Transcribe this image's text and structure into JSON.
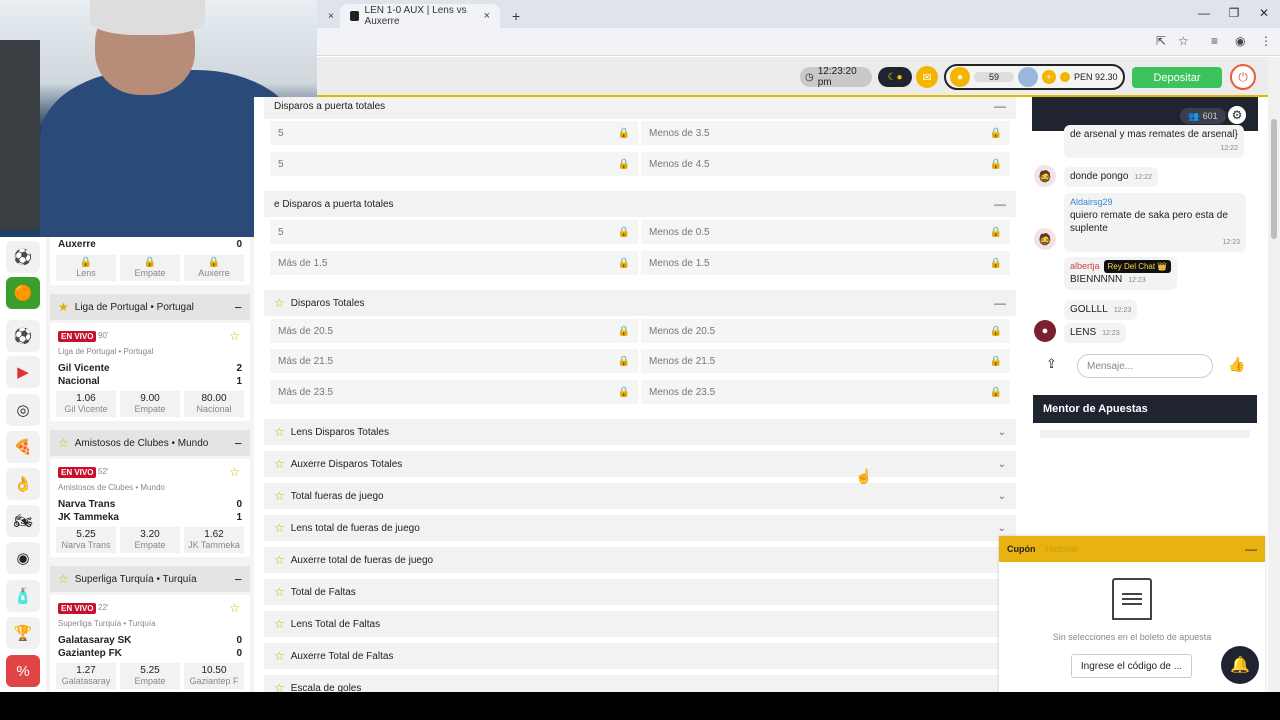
{
  "browser": {
    "tab_title": "LEN 1-0 AUX | Lens vs Auxerre",
    "close": "×",
    "new_tab": "+",
    "win_min": "—",
    "win_max": "❐",
    "win_close": "✕"
  },
  "header": {
    "clock": "12:23:20 pm",
    "coins": "59",
    "balance": "PEN 92.30",
    "deposit": "Depositar"
  },
  "rail": {
    "icons": [
      "soccer-ball-icon",
      "coin-icon",
      "soccer-ball-icon",
      "play-icon",
      "target-icon",
      "slot-icon",
      "hand-icon",
      "racing-icon",
      "roulette-icon",
      "bottle-icon",
      "trophy-icon",
      "percent-icon"
    ]
  },
  "matches": {
    "partial": {
      "team": "Auxerre",
      "score": "0",
      "odds": [
        "Lens",
        "Empate",
        "Auxerre"
      ]
    },
    "leagues": [
      {
        "name": "Liga de Portugal • Portugal",
        "live": "EN VIVO",
        "minute": "90'",
        "sub": "Liga de Portugal • Portugal",
        "home": "Gil Vicente",
        "home_score": "2",
        "away": "Nacional",
        "away_score": "1",
        "odds": [
          {
            "v": "1.06",
            "l": "Gil Vicente"
          },
          {
            "v": "9.00",
            "l": "Empate"
          },
          {
            "v": "80.00",
            "l": "Nacional"
          }
        ]
      },
      {
        "name": "Amistosos de Clubes • Mundo",
        "live": "EN VIVO",
        "minute": "52'",
        "sub": "Amistosos de Clubes • Mundo",
        "home": "Narva Trans",
        "home_score": "0",
        "away": "JK Tammeka",
        "away_score": "1",
        "odds": [
          {
            "v": "5.25",
            "l": "Narva Trans"
          },
          {
            "v": "3.20",
            "l": "Empate"
          },
          {
            "v": "1.62",
            "l": "JK Tammeka"
          }
        ]
      },
      {
        "name": "Superliga Turquía • Turquía",
        "live": "EN VIVO",
        "minute": "22'",
        "sub": "Superliga Turquía • Turquía",
        "home": "Galatasaray SK",
        "home_score": "0",
        "away": "Gaziantep FK",
        "away_score": "0",
        "odds": [
          {
            "v": "1.27",
            "l": "Galatasaray"
          },
          {
            "v": "5.25",
            "l": "Empate"
          },
          {
            "v": "10.50",
            "l": "Gaziantep F"
          }
        ]
      }
    ]
  },
  "markets": {
    "m1": {
      "title": "Disparos a puerta totales",
      "rows": [
        [
          "5",
          "Menos de 3.5"
        ],
        [
          "5",
          "Menos de 4.5"
        ]
      ]
    },
    "m2": {
      "title": "e Disparos a puerta totales",
      "rows": [
        [
          "5",
          "Menos de 0.5"
        ],
        [
          "Más de 1.5",
          "Menos de 1.5"
        ]
      ]
    },
    "m3": {
      "title": "Disparos Totales",
      "rows": [
        [
          "Más de 20.5",
          "Menos de 20.5"
        ],
        [
          "Más de 21.5",
          "Menos de 21.5"
        ],
        [
          "Más de 23.5",
          "Menos de 23.5"
        ]
      ]
    },
    "collapsed": [
      "Lens Disparos Totales",
      "Auxerre Disparos Totales",
      "Total fueras de juego",
      "Lens total de fueras de juego",
      "Auxerre total de fueras de juego",
      "Total de Faltas",
      "Lens Total de Faltas",
      "Auxerre Total de Faltas",
      "Escala de goles"
    ]
  },
  "chat": {
    "users": "601",
    "m0": "de arsenal y mas remates de arsenal}",
    "m0_time": "12:22",
    "m1": "donde pongo",
    "m1_time": "12:22",
    "m2_user": "Aldairsg29",
    "m2": "quiero remate de saka pero esta de suplente",
    "m2_time": "12:23",
    "m3_user": "albertja",
    "m3_badge": "Rey Del Chat 👑",
    "m3": "BIENNNNN",
    "m3_time": "12:23",
    "m4": "GOLLLL",
    "m4_time": "12:23",
    "m5": "LENS",
    "m5_time": "12:23",
    "placeholder": "Mensaje...",
    "mentor": "Mentor de Apuestas"
  },
  "coupon": {
    "tab1": "Cupón",
    "tab2": "Historial",
    "empty": "Sin selecciones en el boleto de apuesta",
    "code": "Ingrese el código de ..."
  },
  "colors": {
    "accent": "#e8b311",
    "live": "#c8102e",
    "deposit": "#3cc35b",
    "dark": "#1f2430"
  }
}
